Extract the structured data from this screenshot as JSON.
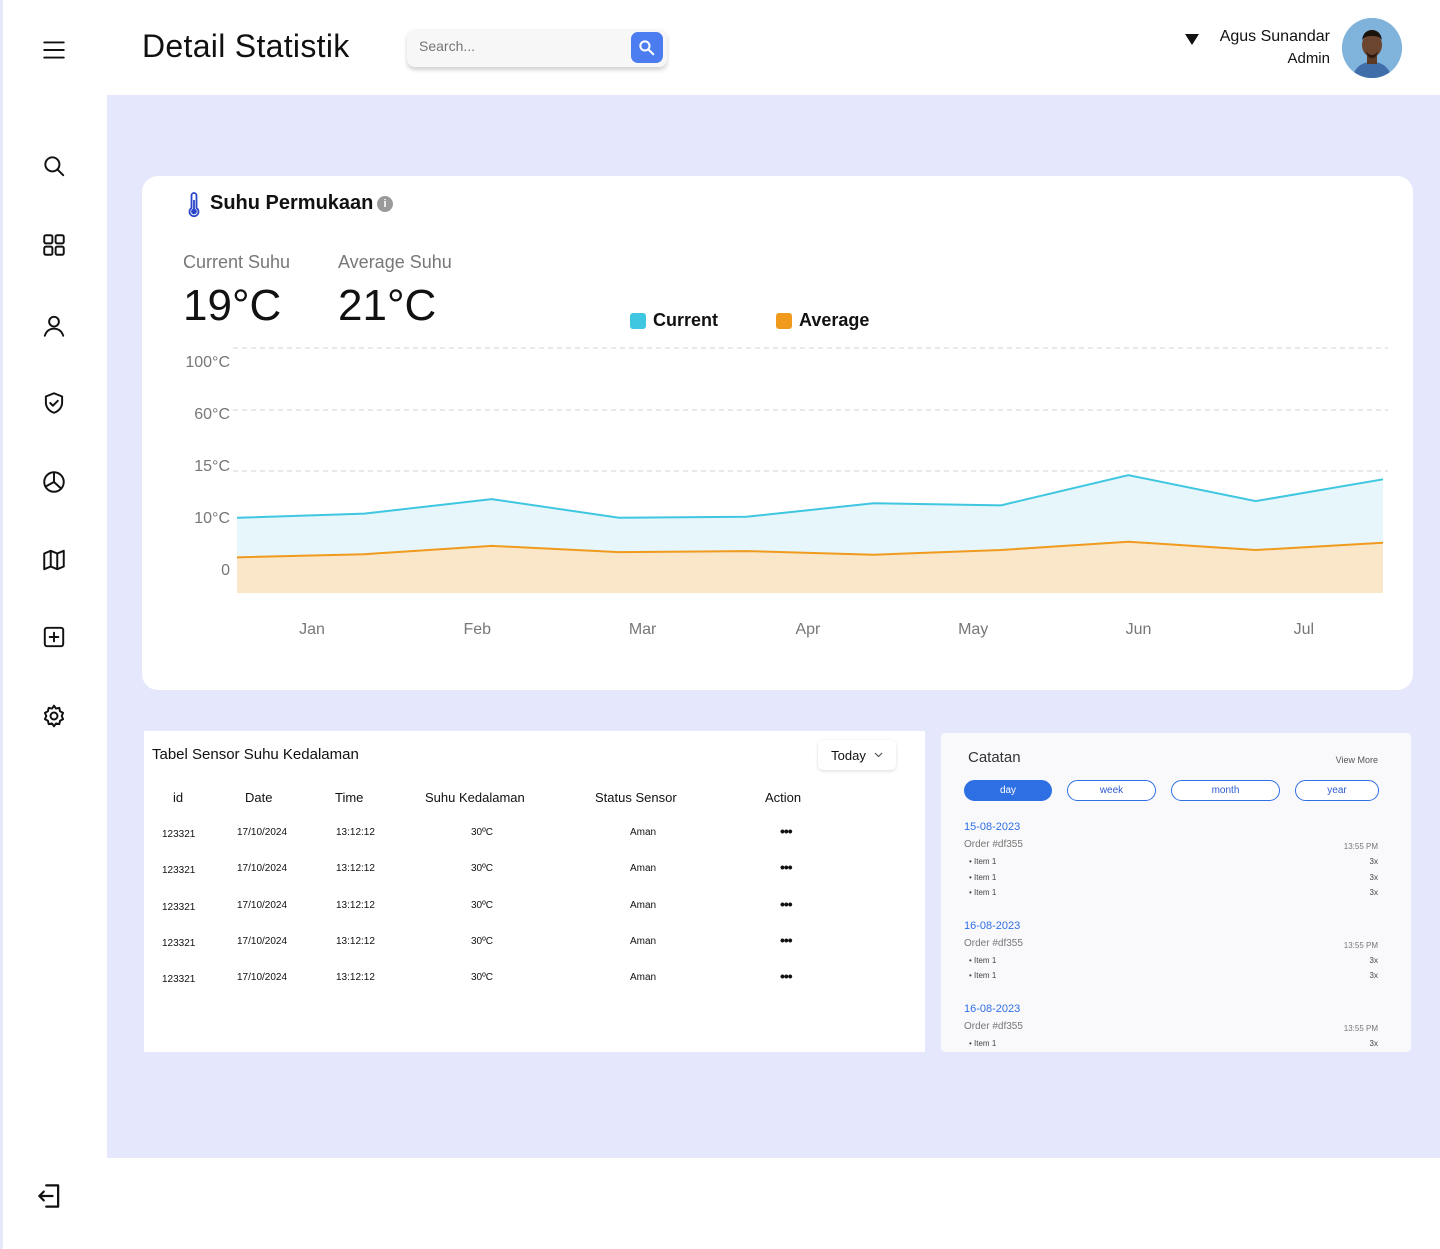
{
  "header": {
    "title": "Detail Statistik",
    "search_placeholder": "Search...",
    "user_name": "Agus Sunandar",
    "user_role": "Admin"
  },
  "sidebar": {
    "items": [
      "menu-icon",
      "search-icon",
      "dashboard-icon",
      "user-icon",
      "shield-icon",
      "pie-chart-icon",
      "map-icon",
      "add-box-icon",
      "gear-icon",
      "logout-icon"
    ]
  },
  "stats_card": {
    "title": "Suhu Permukaan",
    "current_label": "Current Suhu",
    "current_value": "19°C",
    "average_label": "Average Suhu",
    "average_value": "21°C"
  },
  "chart_data": {
    "type": "area",
    "title": "",
    "categories": [
      "Jan",
      "Feb",
      "Mar",
      "Apr",
      "May",
      "Jun",
      "Jul"
    ],
    "y_tick_labels": [
      "100°C",
      "60°C",
      "15°C",
      "10°C",
      "0"
    ],
    "series": [
      {
        "name": "Current",
        "color": "#3fc6e0",
        "fill": "#e6f6fa",
        "values": [
          10.5,
          10.9,
          12.3,
          10.5,
          10.6,
          11.9,
          11.7,
          14.6,
          12.1,
          14.2
        ]
      },
      {
        "name": "Average",
        "color": "#f09a1e",
        "fill": "#fae6c9",
        "values": [
          3.4,
          4.0,
          5.6,
          4.4,
          4.6,
          3.9,
          4.8,
          6.4,
          4.8,
          6.2
        ]
      }
    ],
    "legend_position": "top",
    "grid": true
  },
  "table": {
    "title": "Tabel Sensor Suhu Kedalaman",
    "filter": "Today",
    "columns": [
      "id",
      "Date",
      "Time",
      "Suhu Kedalaman",
      "Status Sensor",
      "Action"
    ],
    "rows": [
      [
        "123321",
        "17/10/2024",
        "13:12:12",
        "30ºC",
        "Aman",
        "•••"
      ],
      [
        "123321",
        "17/10/2024",
        "13:12:12",
        "30ºC",
        "Aman",
        "•••"
      ],
      [
        "123321",
        "17/10/2024",
        "13:12:12",
        "30ºC",
        "Aman",
        "•••"
      ],
      [
        "123321",
        "17/10/2024",
        "13:12:12",
        "30ºC",
        "Aman",
        "•••"
      ],
      [
        "123321",
        "17/10/2024",
        "13:12:12",
        "30ºC",
        "Aman",
        "•••"
      ]
    ]
  },
  "notes": {
    "title": "Catatan",
    "view_more": "View More",
    "tabs": [
      "day",
      "week",
      "month",
      "year"
    ],
    "active_tab": "day",
    "groups": [
      {
        "date": "15-08-2023",
        "order": "Order #df355",
        "time": "13:55 PM",
        "items": [
          {
            "label": "Item 1",
            "qty": "3x"
          },
          {
            "label": "Item 1",
            "qty": "3x"
          },
          {
            "label": "Item 1",
            "qty": "3x"
          }
        ]
      },
      {
        "date": "16-08-2023",
        "order": "Order #df355",
        "time": "13:55 PM",
        "items": [
          {
            "label": "Item 1",
            "qty": "3x"
          },
          {
            "label": "Item 1",
            "qty": "3x"
          }
        ]
      },
      {
        "date": "16-08-2023",
        "order": "Order #df355",
        "time": "13:55 PM",
        "items": [
          {
            "label": "Item 1",
            "qty": "3x"
          }
        ]
      }
    ]
  }
}
